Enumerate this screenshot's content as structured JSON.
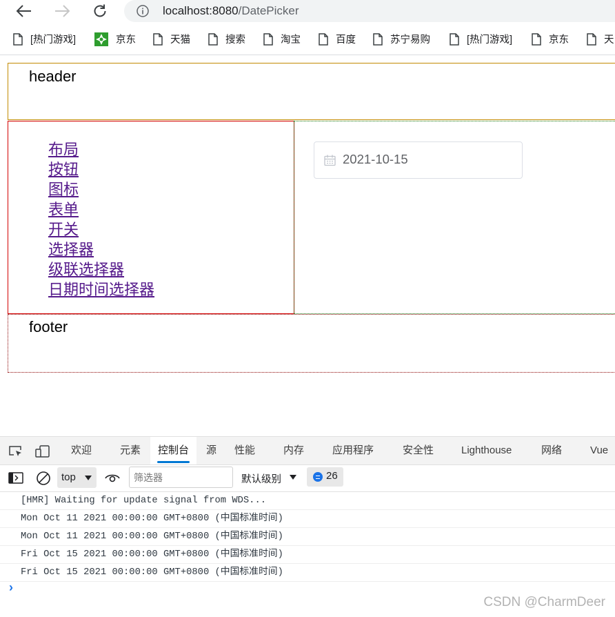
{
  "browser": {
    "url_host": "localhost:8080",
    "url_path": "/DatePicker",
    "bookmarks": [
      {
        "label": "[热门游戏]",
        "icon": "page-icon"
      },
      {
        "label": "京东",
        "icon": "jd-logo-icon"
      },
      {
        "label": "天猫",
        "icon": "page-icon"
      },
      {
        "label": "搜索",
        "icon": "page-icon"
      },
      {
        "label": "淘宝",
        "icon": "page-icon"
      },
      {
        "label": "百度",
        "icon": "page-icon"
      },
      {
        "label": "苏宁易购",
        "icon": "page-icon"
      },
      {
        "label": "[热门游戏]",
        "icon": "page-icon"
      },
      {
        "label": "京东",
        "icon": "page-icon"
      },
      {
        "label": "天",
        "icon": "page-icon"
      }
    ]
  },
  "page": {
    "header": "header",
    "footer": "footer",
    "nav_links": [
      "布局",
      "按钮",
      "图标",
      "表单",
      "开关",
      "选择器",
      "级联选择器",
      "日期时间选择器"
    ],
    "date_value": "2021-10-15"
  },
  "devtools": {
    "tabs": [
      {
        "label": "欢迎",
        "active": false
      },
      {
        "label": "元素",
        "active": false
      },
      {
        "label": "控制台",
        "active": true
      },
      {
        "label": "源",
        "active": false
      },
      {
        "label": "性能",
        "active": false
      },
      {
        "label": "内存",
        "active": false
      },
      {
        "label": "应用程序",
        "active": false
      },
      {
        "label": "安全性",
        "active": false
      },
      {
        "label": "Lighthouse",
        "active": false
      },
      {
        "label": "网络",
        "active": false
      },
      {
        "label": "Vue",
        "active": false
      }
    ],
    "context": "top",
    "filter_placeholder": "筛选器",
    "level": "默认级别",
    "message_count": "26",
    "logs": [
      "[HMR] Waiting for update signal from WDS...",
      "Mon Oct 11 2021 00:00:00 GMT+0800 (中国标准时间)",
      "Mon Oct 11 2021 00:00:00 GMT+0800 (中国标准时间)",
      "Fri Oct 15 2021 00:00:00 GMT+0800 (中国标准时间)",
      "Fri Oct 15 2021 00:00:00 GMT+0800 (中国标准时间)"
    ],
    "prompt": "›"
  },
  "watermark": "CSDN @CharmDeer"
}
